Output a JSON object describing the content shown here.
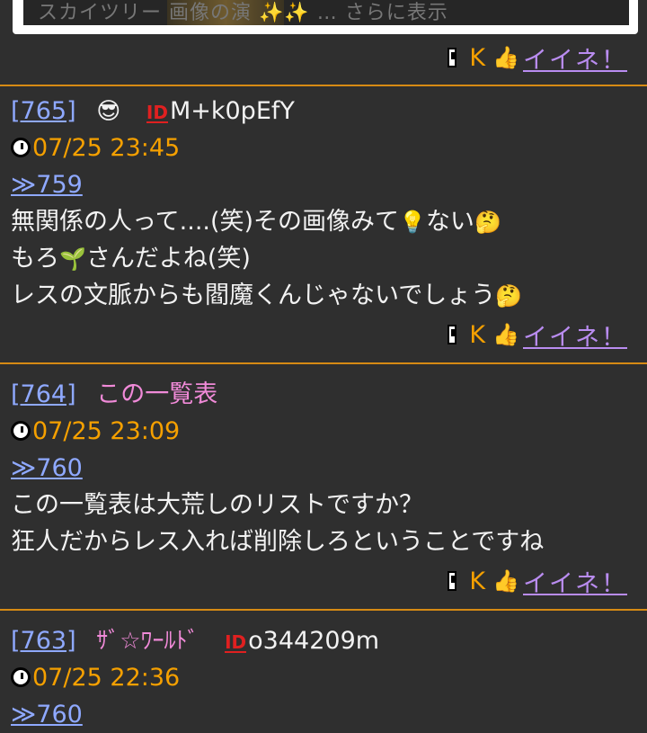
{
  "top_card": {
    "text": "スカイツリー 画像の演 ✨✨ … さらに表示"
  },
  "footer": {
    "k": "K",
    "thumb": "👍",
    "iine": "イイネ！"
  },
  "posts": [
    {
      "num": "[765]",
      "name_emoji": "😎",
      "id_mark": "ID",
      "id": "M+k0pEfY",
      "date": "07/25 23:45",
      "reply": "≫759",
      "lines": [
        {
          "text": "無関係の人って....(笑)その画像みて",
          "emoji": "💡",
          "after": "ない",
          "emoji2": "🤔"
        },
        {
          "text": "もろ",
          "emoji": "🌱",
          "after": "さんだよね(笑)",
          "emoji2": ""
        },
        {
          "text": "レスの文脈からも閻魔くんじゃないでしょう",
          "emoji": "🤔",
          "after": "",
          "emoji2": ""
        }
      ]
    },
    {
      "num": "[764]",
      "name": "この一覧表",
      "date": "07/25 23:09",
      "reply": "≫760",
      "lines": [
        {
          "text": "この一覧表は大荒しのリストですか？"
        },
        {
          "text": "狂人だからレス入れば削除しろということですね"
        }
      ]
    },
    {
      "num": "[763]",
      "name": "ｻﾞ☆ﾜｰﾙﾄﾞ",
      "id_mark": "ID",
      "id": "o344209m",
      "date": "07/25 22:36",
      "reply": "≫760"
    }
  ]
}
